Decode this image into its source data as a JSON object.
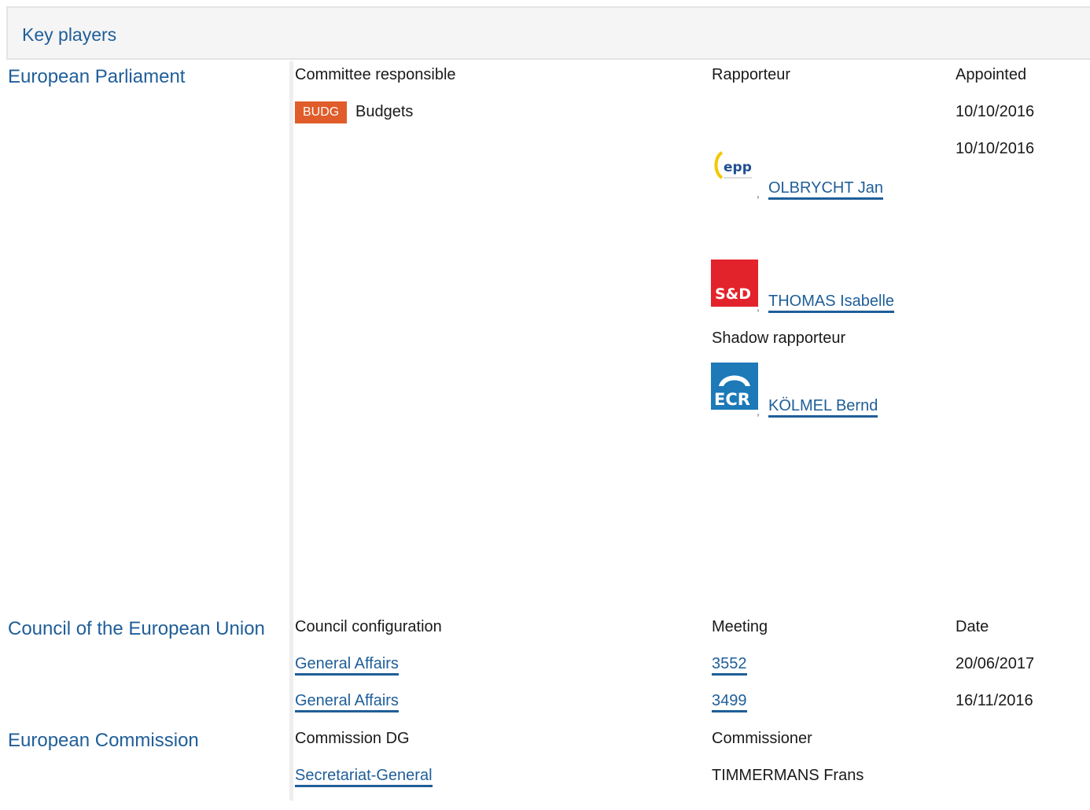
{
  "header": {
    "title": "Key players"
  },
  "parliament": {
    "name": "European Parliament",
    "col_committee": "Committee responsible",
    "col_rapporteur": "Rapporteur",
    "col_appointed": "Appointed",
    "committee_badge": "BUDG",
    "committee_name": "Budgets",
    "dates": [
      "10/10/2016",
      "10/10/2016"
    ],
    "rapporteurs": [
      {
        "party": "epp",
        "name": "OLBRYCHT Jan"
      },
      {
        "party": "S&D",
        "name": "THOMAS Isabelle"
      }
    ],
    "shadow_label": "Shadow rapporteur",
    "shadow": {
      "party": "ECR",
      "name": "KÖLMEL Bernd"
    }
  },
  "council": {
    "name": "Council of the European Union",
    "col_config": "Council configuration",
    "col_meeting": "Meeting",
    "col_date": "Date",
    "rows": [
      {
        "config": "General Affairs",
        "meeting": "3552",
        "date": "20/06/2017"
      },
      {
        "config": "General Affairs",
        "meeting": "3499",
        "date": "16/11/2016"
      }
    ]
  },
  "commission": {
    "name": "European Commission",
    "col_dg": "Commission DG",
    "col_commissioner": "Commissioner",
    "dg": "Secretariat-General",
    "commissioner": "TIMMERMANS Frans"
  },
  "colors": {
    "link": "#1f5e99",
    "badge": "#e05c2a",
    "sd_red": "#e3232b",
    "ecr_blue": "#1d79b8"
  }
}
